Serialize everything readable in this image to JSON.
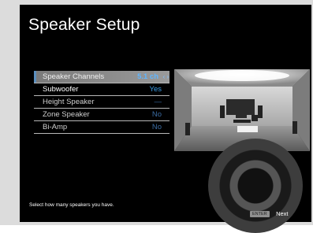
{
  "page": {
    "title": "Speaker Setup",
    "hint": "Select how many speakers you have.",
    "enter_key": "ENTER",
    "next_label": "Next"
  },
  "menu": {
    "items": [
      {
        "label": "Speaker Channels",
        "value": "5.1 ch",
        "selected": true
      },
      {
        "label": "Subwoofer",
        "value": "Yes"
      },
      {
        "label": "Height Speaker",
        "value": "—"
      },
      {
        "label": "Zone Speaker",
        "value": "No"
      },
      {
        "label": "Bi-Amp",
        "value": "No"
      }
    ],
    "selector_arrows": "‹ ›"
  },
  "colors": {
    "accent_value": "#3a9ce6",
    "highlight_row": "#8a8a8a"
  }
}
